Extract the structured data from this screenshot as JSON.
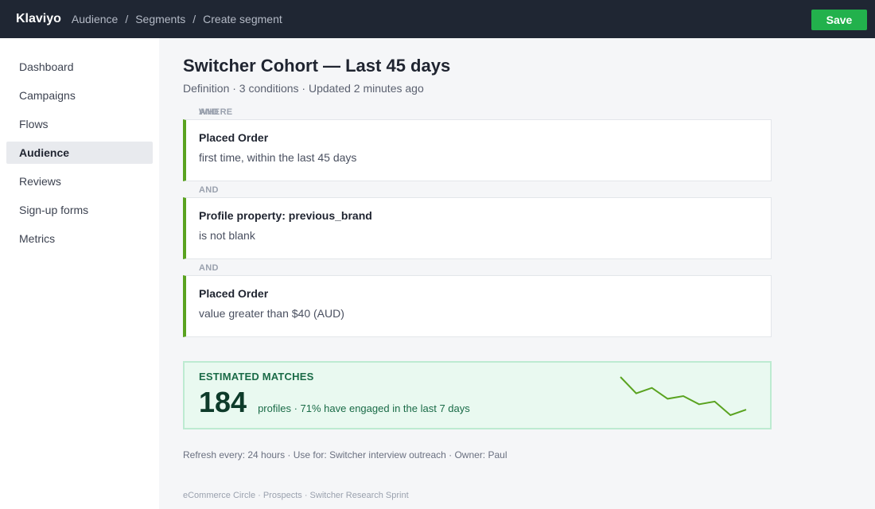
{
  "header": {
    "brand": "Klaviyo",
    "breadcrumbs": [
      "Audience",
      "Segments",
      "Create segment"
    ],
    "save_label": "Save"
  },
  "sidebar": {
    "items": [
      {
        "label": "Dashboard"
      },
      {
        "label": "Campaigns"
      },
      {
        "label": "Flows"
      },
      {
        "label": "Audience",
        "active": true
      },
      {
        "label": "Reviews"
      },
      {
        "label": "Sign-up forms"
      },
      {
        "label": "Metrics"
      }
    ]
  },
  "page": {
    "title": "Switcher Cohort — Last 45 days",
    "subtitle": "Definition · 3 conditions · Updated 2 minutes ago"
  },
  "conditions": {
    "first_joiner": "WHERE",
    "first_joiner_overlap": "AND",
    "joiner": "AND",
    "items": [
      {
        "title": "Placed Order",
        "desc": "first time, within the last 45 days"
      },
      {
        "title": "Profile property: previous_brand",
        "desc": "is not blank"
      },
      {
        "title": "Placed Order",
        "desc": "value greater than $40 (AUD)"
      }
    ]
  },
  "estimate": {
    "label": "ESTIMATED MATCHES",
    "count": "184",
    "desc": "profiles · 71% have engaged in the last 7 days",
    "trend": [
      16,
      10,
      12,
      8,
      9,
      6,
      7,
      2,
      4
    ],
    "color": "#5aa320"
  },
  "meta": "Refresh every: 24 hours · Use for: Switcher interview outreach · Owner: Paul",
  "footer": "eCommerce Circle · Prospects · Switcher Research Sprint",
  "colors": {
    "topbar": "#1f2633",
    "save": "#22b14c",
    "accent": "#5aa320"
  }
}
